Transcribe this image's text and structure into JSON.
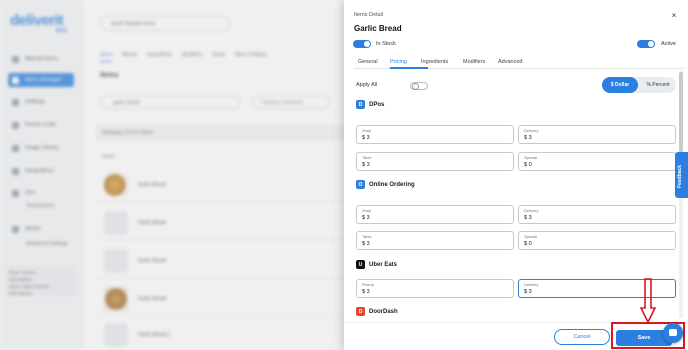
{
  "background": {
    "logo": "deliverit",
    "logo_sub": "BOS",
    "sidebar": {
      "items": [
        {
          "label": "Manual Items"
        },
        {
          "label": "Menu Manager"
        },
        {
          "label": "Settings"
        },
        {
          "label": "Promo Code"
        },
        {
          "label": "Image Library"
        },
        {
          "label": "Integrations"
        },
        {
          "label": "Ons"
        },
        {
          "label": "Admin"
        }
      ],
      "subitems": [
        "Touchscreen",
        "Advanced Settings"
      ],
      "footer": [
        "Store Version",
        "Deli Market",
        "Store Latest Version",
        "Deli Market"
      ]
    },
    "store_select": "Sushi Sample Store",
    "tabs": [
      "Items",
      "Menus",
      "Ingredients",
      "Modifiers",
      "Deals",
      "Menu Settings"
    ],
    "items_title": "Items",
    "search_value": "garlic bread",
    "category_placeholder": "Category Selection",
    "showing_text": "Showing 1-5 of 5 items",
    "column_name": "Name",
    "rows": [
      "Garlic Bread",
      "Garlic Bread",
      "Garlic Bread",
      "Garlic Bread",
      "Garlic Bread 2"
    ]
  },
  "panel": {
    "subtitle": "Items Detail",
    "title": "Garlic Bread",
    "in_stock_label": "In Stock",
    "active_label": "Active",
    "close_symbol": "×",
    "tabs": [
      "General",
      "Pricing",
      "Ingredients",
      "Modifiers",
      "Advanced"
    ],
    "active_tab": "Pricing",
    "apply_all_label": "Apply All",
    "currency_options": [
      "$ Dollar",
      "% Percent"
    ],
    "currency_selected": "$ Dollar",
    "channels": [
      {
        "name": "DPos",
        "icon": "dpos-icon",
        "color": "#2b7fe0",
        "fields": [
          {
            "label": "Shop",
            "value": "$ 3"
          },
          {
            "label": "Delivery",
            "value": "$ 3"
          },
          {
            "label": "Table",
            "value": "$ 3"
          },
          {
            "label": "Special",
            "value": "$ 0"
          }
        ]
      },
      {
        "name": "Online Ordering",
        "icon": "online-ordering-icon",
        "color": "#2b7fe0",
        "fields": [
          {
            "label": "Shop",
            "value": "$ 3"
          },
          {
            "label": "Delivery",
            "value": "$ 3"
          },
          {
            "label": "Table",
            "value": "$ 3"
          },
          {
            "label": "Special",
            "value": "$ 0"
          }
        ]
      },
      {
        "name": "Uber Eats",
        "icon": "uber-eats-icon",
        "color": "#111111",
        "fields": [
          {
            "label": "Pickup",
            "value": "$ 3"
          },
          {
            "label": "Delivery",
            "value": "$ 3"
          }
        ]
      },
      {
        "name": "DoorDash",
        "icon": "doordash-icon",
        "color": "#e8452c"
      }
    ],
    "cancel_label": "Cancel",
    "save_label": "Save"
  },
  "feedback_label": "Feedback",
  "accent_color": "#2b7fe0",
  "highlight_color": "#d7181f"
}
